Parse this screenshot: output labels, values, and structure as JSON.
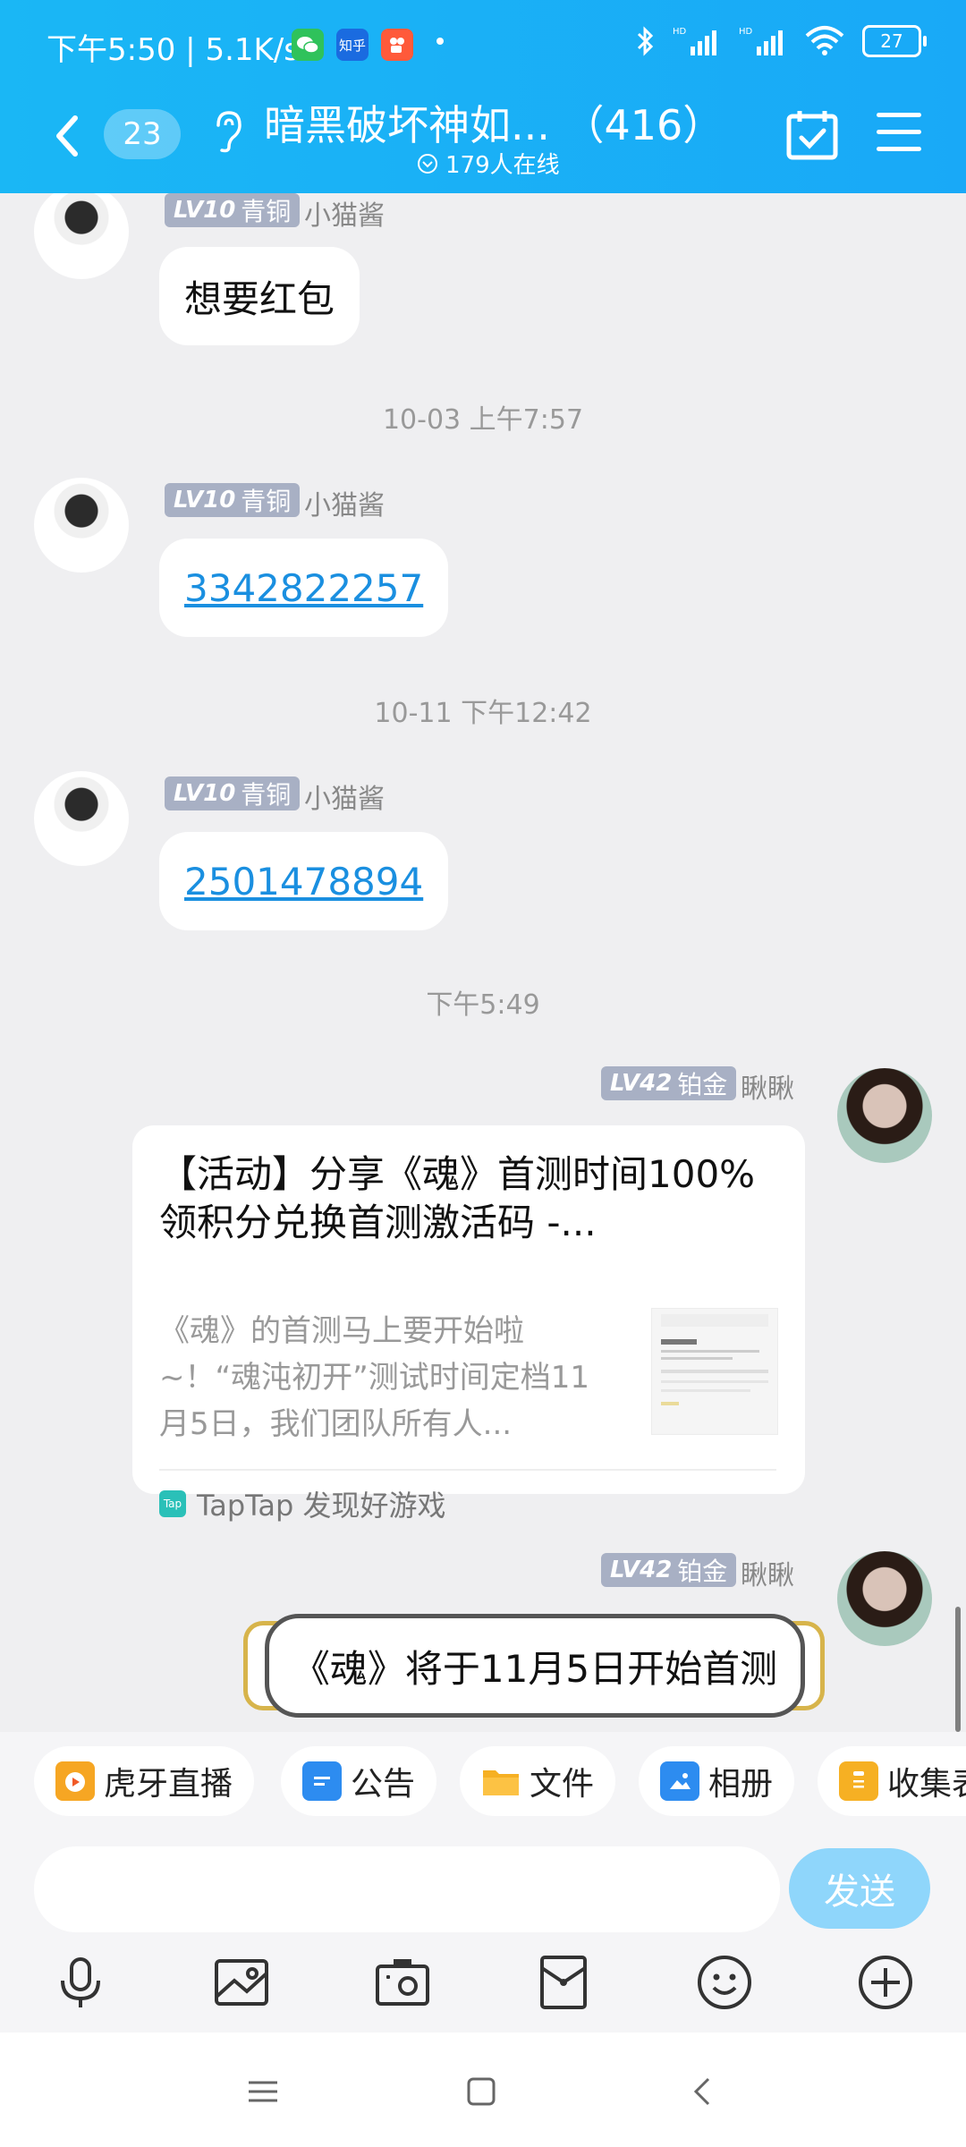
{
  "status_bar": {
    "time": "下午5:50",
    "speed": "5.1K/s",
    "battery": "27",
    "apps": [
      "wechat",
      "zhihu",
      "kuaishou"
    ],
    "apps_text": [
      "",
      "知乎",
      ""
    ]
  },
  "header": {
    "unread": "23",
    "title": "暗黑破坏神如...  （416）",
    "online": "179人在线",
    "bg": "#19b1f6"
  },
  "messages": [
    {
      "badge_lv": "LV10",
      "badge_rank": "青铜",
      "nick": "小猫酱",
      "text": "想要红包"
    },
    {
      "timestamp": "10-03 上午7:57"
    },
    {
      "badge_lv": "LV10",
      "badge_rank": "青铜",
      "nick": "小猫酱",
      "text": "3342822257"
    },
    {
      "timestamp": "10-11 下午12:42"
    },
    {
      "badge_lv": "LV10",
      "badge_rank": "青铜",
      "nick": "小猫酱",
      "text": "2501478894"
    },
    {
      "timestamp": "下午5:49"
    },
    {
      "badge_lv": "LV42",
      "badge_rank": "铂金",
      "nick": "瞅瞅",
      "card": {
        "title": "【活动】分享《魂》首测时间100%领积分兑换首测激活码 -...",
        "desc": "《魂》的首测马上要开始啦~！“魂沌初开”测试时间定档11月5日，我们团队所有人...",
        "source": "TapTap 发现好游戏",
        "tap_icon_text": "Tap"
      }
    },
    {
      "badge_lv": "LV42",
      "badge_rank": "铂金",
      "nick": "瞅瞅",
      "text": "《魂》将于11月5日开始首测"
    }
  ],
  "toolbar": [
    {
      "label": "虎牙直播",
      "icon": "huya-icon",
      "color": "#f6a623"
    },
    {
      "label": "公告",
      "icon": "announcement-icon",
      "color": "#2d8cf0"
    },
    {
      "label": "文件",
      "icon": "folder-icon",
      "color": "#f6b023"
    },
    {
      "label": "相册",
      "icon": "album-icon",
      "color": "#2d8cf0"
    },
    {
      "label": "收集表",
      "icon": "clipboard-icon",
      "color": "#f6b023"
    }
  ],
  "input": {
    "placeholder": "",
    "send_label": "发送"
  }
}
